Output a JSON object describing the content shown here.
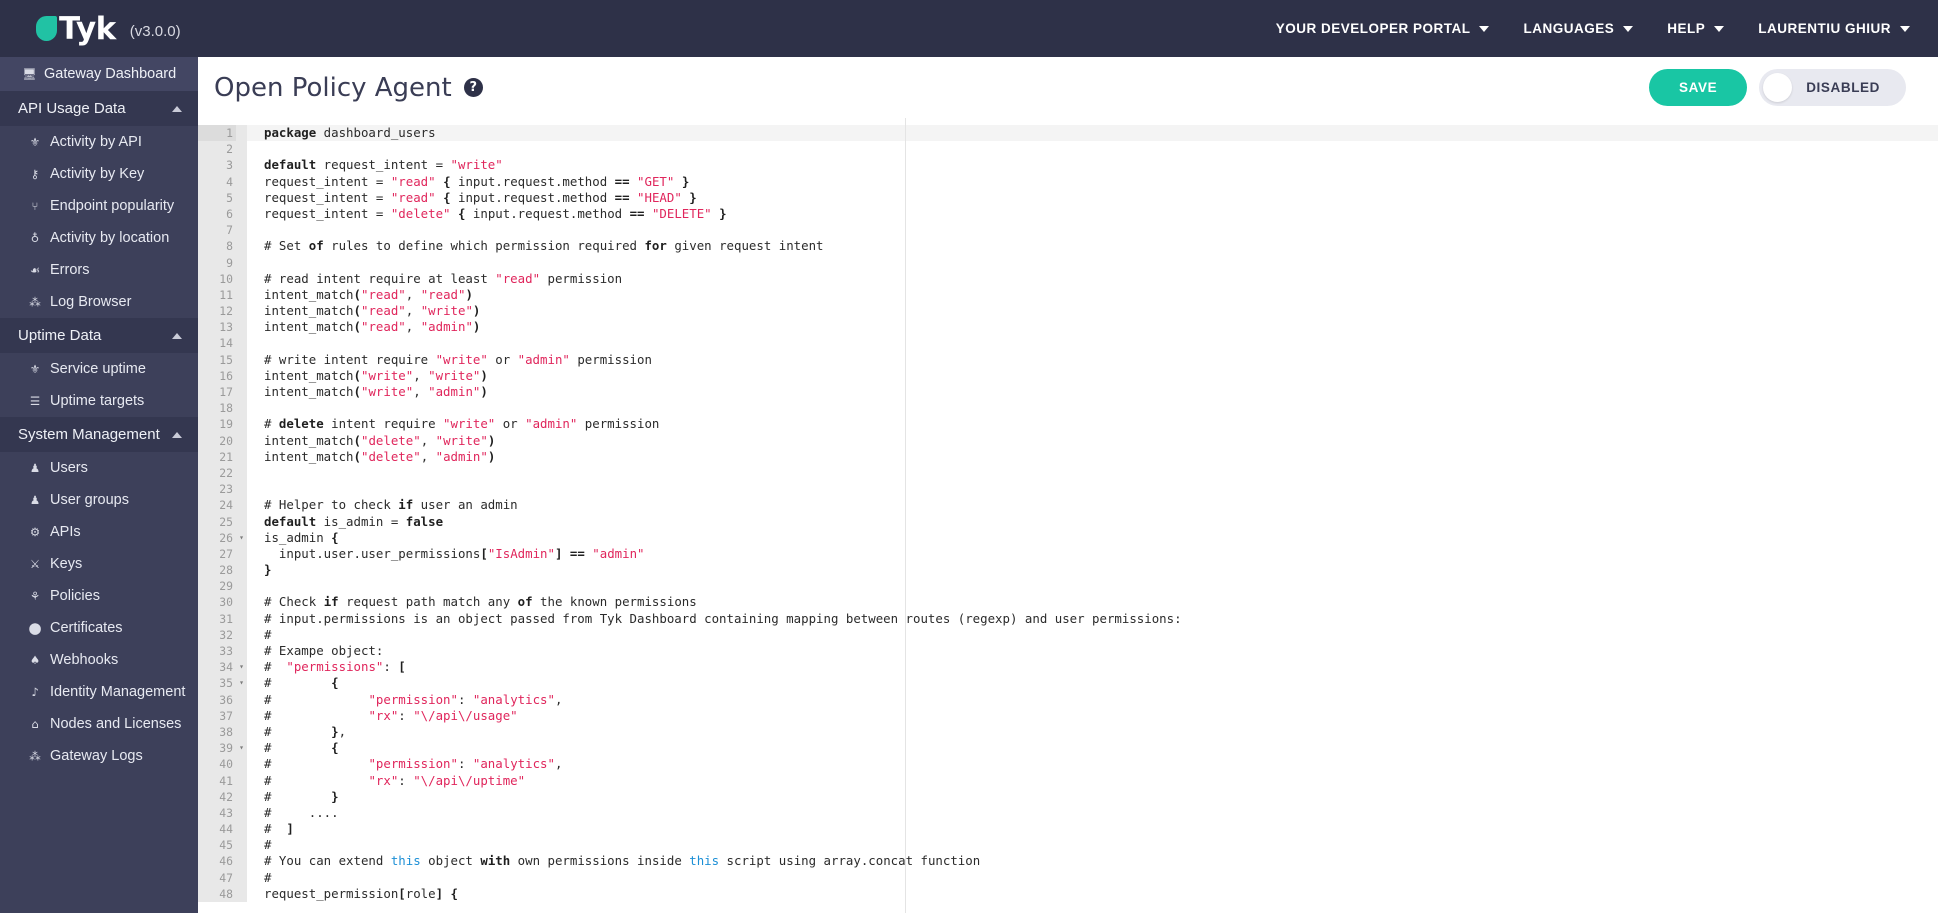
{
  "topbar": {
    "brand_name": "Tyk",
    "version": "(v3.0.0)",
    "nav": [
      {
        "label": "YOUR DEVELOPER PORTAL"
      },
      {
        "label": "LANGUAGES"
      },
      {
        "label": "HELP"
      },
      {
        "label": "LAURENTIU GHIUR"
      }
    ]
  },
  "sidebar": {
    "dashboard": {
      "label": "Gateway Dashboard",
      "icon": "monitor-icon"
    },
    "sections": [
      {
        "label": "API Usage Data",
        "items": [
          {
            "label": "Activity by API",
            "icon": "share-icon"
          },
          {
            "label": "Activity by Key",
            "icon": "key-icon"
          },
          {
            "label": "Endpoint popularity",
            "icon": "branch-icon"
          },
          {
            "label": "Activity by location",
            "icon": "globe-icon"
          },
          {
            "label": "Errors",
            "icon": "bug-icon"
          },
          {
            "label": "Log Browser",
            "icon": "list-icon"
          }
        ]
      },
      {
        "label": "Uptime Data",
        "items": [
          {
            "label": "Service uptime",
            "icon": "share-icon"
          },
          {
            "label": "Uptime targets",
            "icon": "targets-icon"
          }
        ]
      },
      {
        "label": "System Management",
        "items": [
          {
            "label": "Users",
            "icon": "user-icon"
          },
          {
            "label": "User groups",
            "icon": "users-icon"
          },
          {
            "label": "APIs",
            "icon": "gears-icon"
          },
          {
            "label": "Keys",
            "icon": "sitemap-icon"
          },
          {
            "label": "Policies",
            "icon": "shield-icon"
          },
          {
            "label": "Certificates",
            "icon": "certificate-icon"
          },
          {
            "label": "Webhooks",
            "icon": "hook-icon"
          },
          {
            "label": "Identity Management",
            "icon": "id-icon"
          },
          {
            "label": "Nodes and Licenses",
            "icon": "bank-icon"
          },
          {
            "label": "Gateway Logs",
            "icon": "logs-icon"
          }
        ]
      }
    ]
  },
  "page": {
    "title": "Open Policy Agent",
    "help_icon": "question-mark-icon",
    "save_label": "SAVE",
    "toggle_label": "DISABLED",
    "toggle_state": "off",
    "accent_color": "#19c6a4",
    "header_color": "#2e3148"
  },
  "editor": {
    "active_line": 1,
    "lines": [
      {
        "n": 1,
        "fold": "",
        "html": "<span class=\"k\">package</span> dashboard_users"
      },
      {
        "n": 2,
        "fold": "",
        "html": ""
      },
      {
        "n": 3,
        "fold": "",
        "html": "<span class=\"k\">default</span> request_intent = <span class=\"s\">\"write\"</span>"
      },
      {
        "n": 4,
        "fold": "",
        "html": "request_intent = <span class=\"s\">\"read\"</span> <span class=\"p\">{</span> input.request.method <span class=\"p\">==</span> <span class=\"s\">\"GET\"</span> <span class=\"p\">}</span>"
      },
      {
        "n": 5,
        "fold": "",
        "html": "request_intent = <span class=\"s\">\"read\"</span> <span class=\"p\">{</span> input.request.method <span class=\"p\">==</span> <span class=\"s\">\"HEAD\"</span> <span class=\"p\">}</span>"
      },
      {
        "n": 6,
        "fold": "",
        "html": "request_intent = <span class=\"s\">\"delete\"</span> <span class=\"p\">{</span> input.request.method <span class=\"p\">==</span> <span class=\"s\">\"DELETE\"</span> <span class=\"p\">}</span>"
      },
      {
        "n": 7,
        "fold": "",
        "html": ""
      },
      {
        "n": 8,
        "fold": "",
        "html": "# Set <span class=\"k\">of</span> rules to define which permission required <span class=\"k\">for</span> given request intent"
      },
      {
        "n": 9,
        "fold": "",
        "html": ""
      },
      {
        "n": 10,
        "fold": "",
        "html": "# read intent require at least <span class=\"s\">\"read\"</span> permission"
      },
      {
        "n": 11,
        "fold": "",
        "html": "intent_match<span class=\"p\">(</span><span class=\"s\">\"read\"</span>, <span class=\"s\">\"read\"</span><span class=\"p\">)</span>"
      },
      {
        "n": 12,
        "fold": "",
        "html": "intent_match<span class=\"p\">(</span><span class=\"s\">\"read\"</span>, <span class=\"s\">\"write\"</span><span class=\"p\">)</span>"
      },
      {
        "n": 13,
        "fold": "",
        "html": "intent_match<span class=\"p\">(</span><span class=\"s\">\"read\"</span>, <span class=\"s\">\"admin\"</span><span class=\"p\">)</span>"
      },
      {
        "n": 14,
        "fold": "",
        "html": ""
      },
      {
        "n": 15,
        "fold": "",
        "html": "# write intent require <span class=\"s\">\"write\"</span> or <span class=\"s\">\"admin\"</span> permission"
      },
      {
        "n": 16,
        "fold": "",
        "html": "intent_match<span class=\"p\">(</span><span class=\"s\">\"write\"</span>, <span class=\"s\">\"write\"</span><span class=\"p\">)</span>"
      },
      {
        "n": 17,
        "fold": "",
        "html": "intent_match<span class=\"p\">(</span><span class=\"s\">\"write\"</span>, <span class=\"s\">\"admin\"</span><span class=\"p\">)</span>"
      },
      {
        "n": 18,
        "fold": "",
        "html": ""
      },
      {
        "n": 19,
        "fold": "",
        "html": "# <span class=\"k\">delete</span> intent require <span class=\"s\">\"write\"</span> or <span class=\"s\">\"admin\"</span> permission"
      },
      {
        "n": 20,
        "fold": "",
        "html": "intent_match<span class=\"p\">(</span><span class=\"s\">\"delete\"</span>, <span class=\"s\">\"write\"</span><span class=\"p\">)</span>"
      },
      {
        "n": 21,
        "fold": "",
        "html": "intent_match<span class=\"p\">(</span><span class=\"s\">\"delete\"</span>, <span class=\"s\">\"admin\"</span><span class=\"p\">)</span>"
      },
      {
        "n": 22,
        "fold": "",
        "html": ""
      },
      {
        "n": 23,
        "fold": "",
        "html": ""
      },
      {
        "n": 24,
        "fold": "",
        "html": "# Helper to check <span class=\"k\">if</span> user an admin"
      },
      {
        "n": 25,
        "fold": "",
        "html": "<span class=\"k\">default</span> is_admin = <span class=\"k\">false</span>"
      },
      {
        "n": 26,
        "fold": "▾",
        "html": "is_admin <span class=\"p\">{</span>"
      },
      {
        "n": 27,
        "fold": "",
        "html": "  input.user.user_permissions<span class=\"p\">[</span><span class=\"s\">\"IsAdmin\"</span><span class=\"p\">]</span> <span class=\"p\">==</span> <span class=\"s\">\"admin\"</span>"
      },
      {
        "n": 28,
        "fold": "",
        "html": "<span class=\"p\">}</span>"
      },
      {
        "n": 29,
        "fold": "",
        "html": ""
      },
      {
        "n": 30,
        "fold": "",
        "html": "# Check <span class=\"k\">if</span> request path match any <span class=\"k\">of</span> the known permissions"
      },
      {
        "n": 31,
        "fold": "",
        "html": "# input.permissions is an object passed from Tyk Dashboard containing mapping between routes (regexp) and user permissions:"
      },
      {
        "n": 32,
        "fold": "",
        "html": "#"
      },
      {
        "n": 33,
        "fold": "",
        "html": "# Exampe object:"
      },
      {
        "n": 34,
        "fold": "▾",
        "html": "#  <span class=\"s\">\"permissions\"</span>: <span class=\"p\">[</span>"
      },
      {
        "n": 35,
        "fold": "▾",
        "html": "#        <span class=\"p\">{</span>"
      },
      {
        "n": 36,
        "fold": "",
        "html": "#             <span class=\"s\">\"permission\"</span>: <span class=\"s\">\"analytics\"</span>,"
      },
      {
        "n": 37,
        "fold": "",
        "html": "#             <span class=\"s\">\"rx\"</span>: <span class=\"s\">\"\\/api\\/usage\"</span>"
      },
      {
        "n": 38,
        "fold": "",
        "html": "#        <span class=\"p\">}</span>,"
      },
      {
        "n": 39,
        "fold": "▾",
        "html": "#        <span class=\"p\">{</span>"
      },
      {
        "n": 40,
        "fold": "",
        "html": "#             <span class=\"s\">\"permission\"</span>: <span class=\"s\">\"analytics\"</span>,"
      },
      {
        "n": 41,
        "fold": "",
        "html": "#             <span class=\"s\">\"rx\"</span>: <span class=\"s\">\"\\/api\\/uptime\"</span>"
      },
      {
        "n": 42,
        "fold": "",
        "html": "#        <span class=\"p\">}</span>"
      },
      {
        "n": 43,
        "fold": "",
        "html": "#     ...."
      },
      {
        "n": 44,
        "fold": "",
        "html": "#  <span class=\"p\">]</span>"
      },
      {
        "n": 45,
        "fold": "",
        "html": "#"
      },
      {
        "n": 46,
        "fold": "",
        "html": "# You can extend <span class=\"b\">this</span> object <span class=\"k\">with</span> own permissions inside <span class=\"b\">this</span> script using array.concat function"
      },
      {
        "n": 47,
        "fold": "",
        "html": "#"
      },
      {
        "n": 48,
        "fold": "",
        "html": "request_permission<span class=\"p\">[</span>role<span class=\"p\">]</span> <span class=\"p\">{</span>"
      }
    ]
  }
}
